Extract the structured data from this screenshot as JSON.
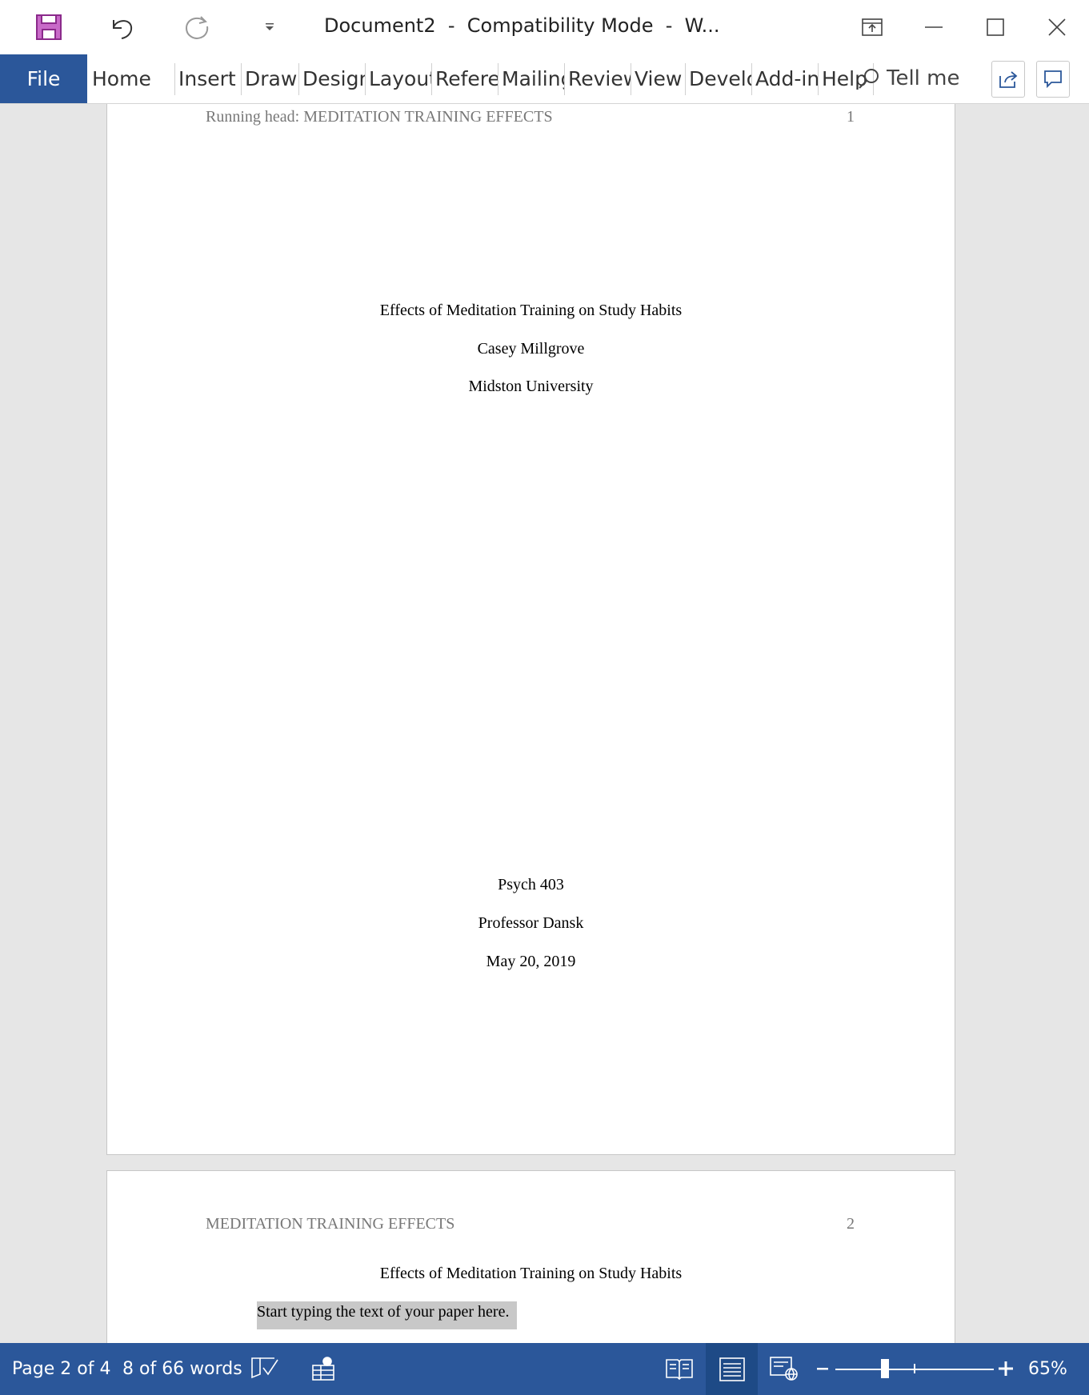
{
  "titlebar": {
    "title": "Document2  -  Compatibility Mode  -  W...",
    "save_icon": "save-icon",
    "undo_icon": "undo-icon",
    "redo_icon": "redo-icon",
    "customize_icon": "dropdown-arrow-icon",
    "accent_color": "#a33fa3"
  },
  "ribbon": {
    "file_label": "File",
    "tabs": [
      "Home",
      "Insert",
      "Draw",
      "Design",
      "Layout",
      "References",
      "Mailings",
      "Review",
      "View",
      "Developer",
      "Add-ins",
      "Help"
    ],
    "tell_me": "Tell me",
    "brand_color": "#2b579a"
  },
  "page1": {
    "running_head": "Running head: MEDITATION TRAINING EFFECTS",
    "page_number": "1",
    "title": "Effects of Meditation Training on Study Habits",
    "author": "Casey Millgrove",
    "institution": "Midston University",
    "course": "Psych 403",
    "professor": "Professor Dansk",
    "date": "May 20, 2019"
  },
  "page2": {
    "running_head": "MEDITATION TRAINING EFFECTS",
    "page_number": "2",
    "title": "Effects of Meditation Training on Study Habits",
    "placeholder": "Start typing the text of your paper here."
  },
  "statusbar": {
    "page_info": "Page 2 of 4",
    "word_count": "8 of 66 words",
    "zoom": "65%"
  }
}
